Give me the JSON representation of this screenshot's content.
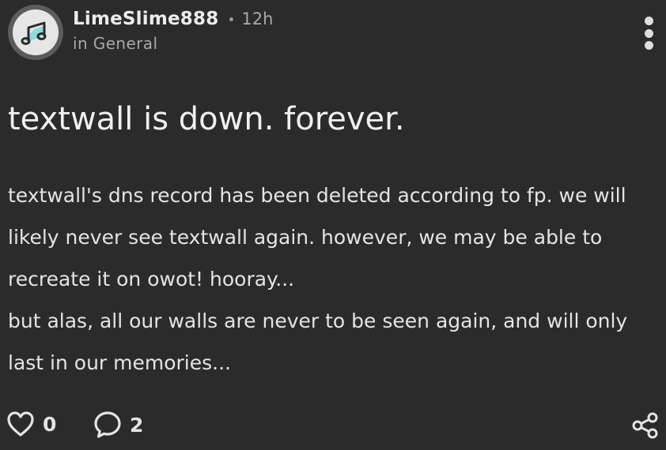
{
  "post": {
    "author": {
      "username": "LimeSlime888",
      "avatar_icon": "music-note-icon"
    },
    "time_ago": "12h",
    "category": "in General",
    "title": "textwall is down. forever.",
    "body_paragraphs": [
      "textwall's dns record has been deleted according to fp. we will likely never see textwall again. however, we may be able to recreate it on owot! hooray...",
      "but alas, all our walls are never to be seen again, and will only last in our memories..."
    ],
    "likes": "0",
    "comments": "2"
  },
  "icons": {
    "more": "more-vertical-icon",
    "like": "heart-icon",
    "comment": "comment-bubble-icon",
    "share": "share-icon"
  },
  "colors": {
    "background": "#2b2b2b",
    "text": "#e8e8e8",
    "muted": "#a8a8a8",
    "avatar_accent": "#7fd6d6"
  }
}
